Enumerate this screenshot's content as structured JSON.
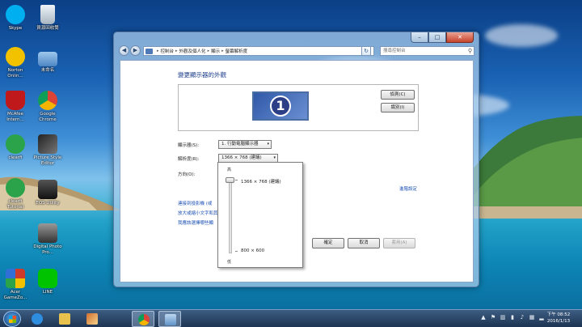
{
  "desktop": {
    "icons": [
      {
        "label": "Skype",
        "icon": "skype-icon",
        "color": "#00aff0"
      },
      {
        "label": "資源回收筒",
        "icon": "recycle-bin-icon",
        "color": "#c9d3dc"
      },
      {
        "label": "Norton Onlin...",
        "icon": "norton-icon",
        "color": "#f2c200"
      },
      {
        "label": "未命名",
        "icon": "folder-icon",
        "color": "#6fa9d8"
      },
      {
        "label": "McAfee Intern...",
        "icon": "mcafee-icon",
        "color": "#c0191c"
      },
      {
        "label": "Google Chrome",
        "icon": "chrome-icon",
        "color": "#4285f4"
      },
      {
        "label": "clearfi",
        "icon": "clearfi-icon",
        "color": "#2aa34a"
      },
      {
        "label": "Picture Style Editor",
        "icon": "picture-style-editor-icon",
        "color": "#555555"
      },
      {
        "label": "clearfi Tutorial",
        "icon": "clearfi-tutorial-icon",
        "color": "#2aa34a"
      },
      {
        "label": "EOS Utility",
        "icon": "eos-utility-icon",
        "color": "#333333"
      },
      {
        "label": "Digital Photo Pro...",
        "icon": "digital-photo-professional-icon",
        "color": "#6b6b6b"
      },
      {
        "label": "Acer GameZo...",
        "icon": "acer-gamezone-icon",
        "color": "#d03a2a"
      },
      {
        "label": "LINE",
        "icon": "line-icon",
        "color": "#00c300"
      }
    ]
  },
  "window": {
    "breadcrumb": [
      "控制台",
      "外觀及個人化",
      "顯示",
      "螢幕解析度"
    ],
    "search_placeholder": "搜尋控制台",
    "heading": "變更顯示器的外觀",
    "monitor_number": "1",
    "detect_button": "偵測(C)",
    "identify_button": "識別(I)",
    "display_label": "顯示器(S):",
    "display_value": "1. 行動電腦顯示器",
    "resolution_label": "解析度(R):",
    "resolution_value": "1366 × 768 (建議)",
    "orientation_label": "方向(O):",
    "advanced_link": "進階設定",
    "links": [
      "連接到投影機 (或",
      "放大或縮小文字和其他",
      "我應該選擇哪些顯"
    ],
    "ok_button": "確定",
    "cancel_button": "取消",
    "apply_button": "套用(A)",
    "resolution_dropdown": {
      "high_label": "高",
      "low_label": "低",
      "top_option": "1366 × 768 (建議)",
      "bottom_option": "800 × 600"
    }
  },
  "taskbar": {
    "time": "下午 08:52",
    "date": "2016/1/13",
    "items": [
      {
        "icon": "internet-explorer-icon",
        "color": "#2f8ddf"
      },
      {
        "icon": "file-explorer-icon",
        "color": "#e9c24e"
      },
      {
        "icon": "paint-icon",
        "color": "#d26f2f"
      },
      {
        "icon": "chrome-icon",
        "color": "#4285f4"
      },
      {
        "icon": "control-panel-icon",
        "color": "#7fb0de"
      }
    ]
  }
}
